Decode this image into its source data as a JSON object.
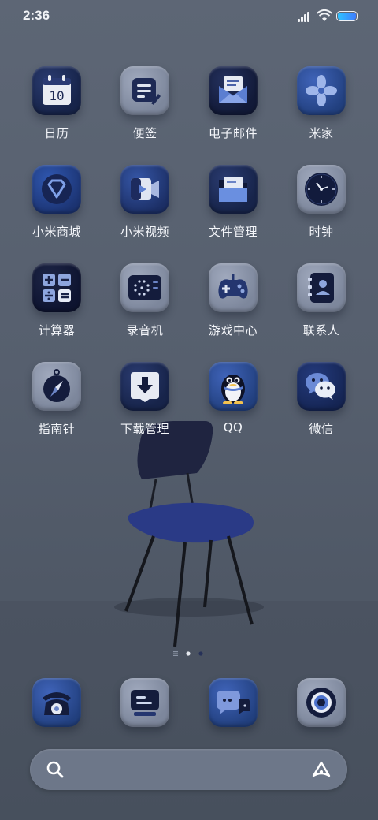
{
  "status_bar": {
    "time": "2:36"
  },
  "apps": [
    {
      "id": "calendar",
      "label": "日历",
      "day": "10",
      "icon": "calendar-icon"
    },
    {
      "id": "notes",
      "label": "便签",
      "icon": "notes-icon"
    },
    {
      "id": "mail",
      "label": "电子邮件",
      "icon": "mail-icon"
    },
    {
      "id": "mijia",
      "label": "米家",
      "icon": "flower-icon"
    },
    {
      "id": "mistore",
      "label": "小米商城",
      "icon": "store-icon"
    },
    {
      "id": "mivideo",
      "label": "小米视频",
      "icon": "video-icon"
    },
    {
      "id": "files",
      "label": "文件管理",
      "icon": "folder-icon"
    },
    {
      "id": "clock",
      "label": "时钟",
      "icon": "clock-icon"
    },
    {
      "id": "calculator",
      "label": "计算器",
      "icon": "calculator-icon"
    },
    {
      "id": "recorder",
      "label": "录音机",
      "icon": "recorder-icon"
    },
    {
      "id": "gamecenter",
      "label": "游戏中心",
      "icon": "gamepad-icon"
    },
    {
      "id": "contacts",
      "label": "联系人",
      "icon": "contacts-icon"
    },
    {
      "id": "compass",
      "label": "指南针",
      "icon": "compass-icon"
    },
    {
      "id": "downloads",
      "label": "下载管理",
      "icon": "download-icon"
    },
    {
      "id": "qq",
      "label": "QQ",
      "icon": "penguin-icon"
    },
    {
      "id": "wechat",
      "label": "微信",
      "icon": "wechat-icon"
    }
  ],
  "dock": [
    {
      "id": "phone",
      "icon": "phone-icon"
    },
    {
      "id": "messages-app",
      "icon": "message-icon"
    },
    {
      "id": "chat",
      "icon": "chat-icon"
    },
    {
      "id": "camera",
      "icon": "camera-icon"
    }
  ],
  "page_indicator": {
    "pages": 2,
    "current": 1
  },
  "search_bar": {
    "left_icon": "search-icon",
    "right_icon": "assistant-icon"
  }
}
